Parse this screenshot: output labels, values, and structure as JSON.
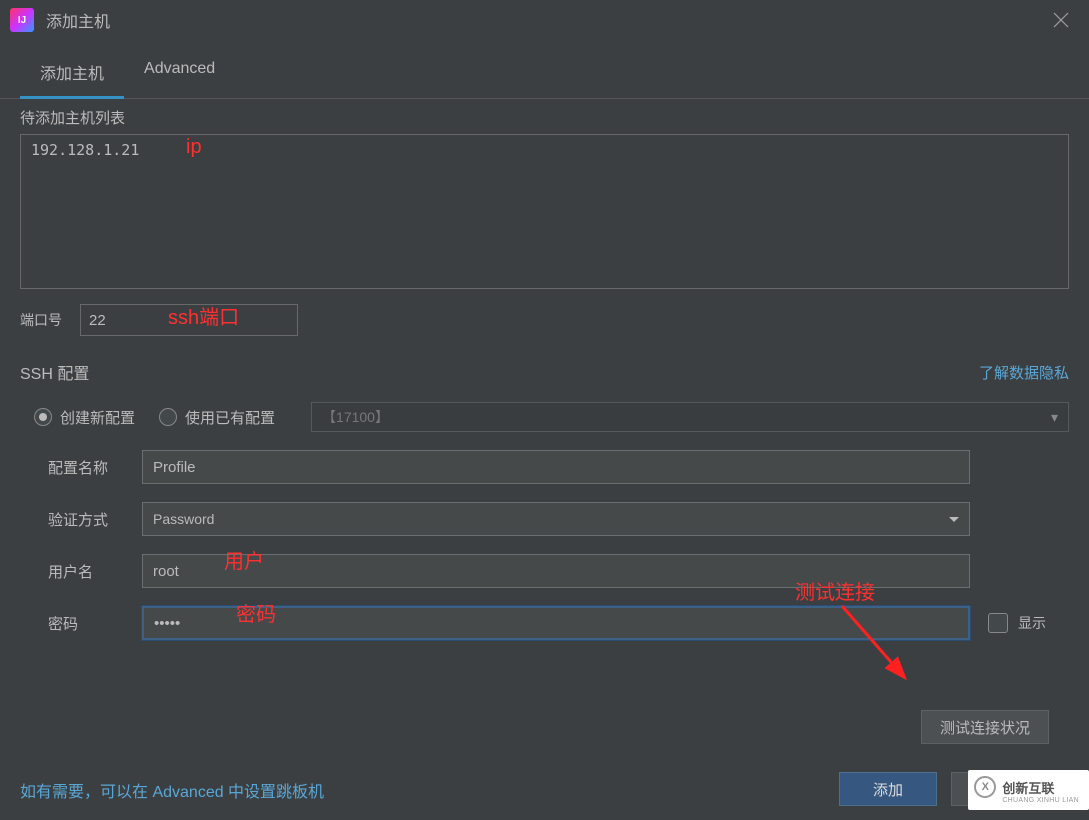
{
  "titlebar": {
    "title": "添加主机"
  },
  "tabs": {
    "add_host": "添加主机",
    "advanced": "Advanced"
  },
  "host_list": {
    "label": "待添加主机列表",
    "value": "192.128.1.21"
  },
  "port": {
    "label": "端口号",
    "value": "22"
  },
  "ssh": {
    "section_title": "SSH 配置",
    "privacy_link": "了解数据隐私",
    "radio_new": "创建新配置",
    "radio_existing": "使用已有配置",
    "existing_dropdown": "【17100】",
    "profile_label": "配置名称",
    "profile_value": "Profile",
    "auth_label": "验证方式",
    "auth_value": "Password",
    "user_label": "用户名",
    "user_value": "root",
    "password_label": "密码",
    "password_value": "•••••",
    "show_label": "显示",
    "test_button": "测试连接状况"
  },
  "hint": "如有需要，可以在 Advanced 中设置跳板机",
  "footer": {
    "add": "添加",
    "cancel": ""
  },
  "annotations": {
    "ip": "ip",
    "ssh_port": "ssh端口",
    "user": "用户",
    "password": "密码",
    "test_connect": "测试连接"
  },
  "watermark": {
    "brand": "创新互联",
    "domain": "CHUANG XINHU LIAN"
  }
}
